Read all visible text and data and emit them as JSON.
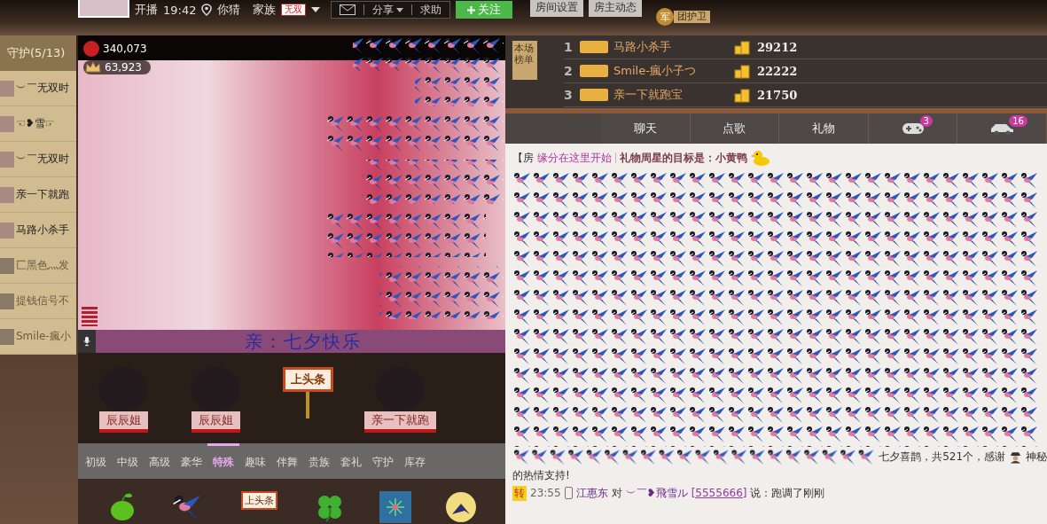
{
  "header": {
    "start_label": "开播",
    "start_time": "19:42",
    "location": "你猜",
    "family_label": "家族",
    "family_badge": "无双",
    "actions": [
      {
        "kind": "mail"
      },
      {
        "kind": "text",
        "label": "分享",
        "dropdown": true
      },
      {
        "kind": "text",
        "label": "求助",
        "dropdown": false
      }
    ],
    "follow_button": "关注",
    "buttons": [
      "房间设置",
      "房主动态"
    ],
    "guard_badge": {
      "icon": "军",
      "label": "团护卫"
    }
  },
  "sidebar": {
    "title": "守护(5/13)",
    "items": [
      {
        "name": "︶￣无双时",
        "online": true
      },
      {
        "name": "☜❥雪☞",
        "online": true
      },
      {
        "name": "︶￣无双时",
        "online": true
      },
      {
        "name": "亲一下就跑",
        "online": true
      },
      {
        "name": "马路小杀手",
        "online": true
      },
      {
        "name": "匚黑色灬发",
        "online": false
      },
      {
        "name": "提钱信号不",
        "online": false
      },
      {
        "name": "Smile-瘋小",
        "online": false
      }
    ]
  },
  "video": {
    "wealth": "340,073",
    "popularity": "63,923",
    "ticker": "亲：七夕快乐"
  },
  "seats": [
    {
      "kind": "user",
      "name": "辰辰姐"
    },
    {
      "kind": "user",
      "name": "辰辰姐"
    },
    {
      "kind": "headline",
      "label": "上头条"
    },
    {
      "kind": "user",
      "name": "亲一下就跑"
    }
  ],
  "gift_tabs": [
    {
      "label": "初级",
      "selected": false
    },
    {
      "label": "中级",
      "selected": false
    },
    {
      "label": "高级",
      "selected": false
    },
    {
      "label": "豪华",
      "selected": false
    },
    {
      "label": "特殊",
      "selected": true
    },
    {
      "label": "趣味",
      "selected": false
    },
    {
      "label": "伴舞",
      "selected": false
    },
    {
      "label": "贵族",
      "selected": false
    },
    {
      "label": "套礼",
      "selected": false
    },
    {
      "label": "守护",
      "selected": false
    },
    {
      "label": "库存",
      "selected": false
    }
  ],
  "gifts": [
    {
      "kind": "bean"
    },
    {
      "kind": "magpie"
    },
    {
      "kind": "headline",
      "label": "上头条"
    },
    {
      "kind": "clover"
    },
    {
      "kind": "firework"
    },
    {
      "kind": "moon"
    }
  ],
  "ranking": {
    "label": "本场榜单",
    "rows": [
      {
        "rank": "1",
        "name": "马路小杀手",
        "score": "29212"
      },
      {
        "rank": "2",
        "name": "Smile-瘋小子つ",
        "score": "22222"
      },
      {
        "rank": "3",
        "name": "亲一下就跑宝",
        "score": "21750"
      }
    ]
  },
  "chat_tabs": [
    {
      "kind": "text",
      "label": "聊天"
    },
    {
      "kind": "text",
      "label": "点歌"
    },
    {
      "kind": "text",
      "label": "礼物"
    },
    {
      "kind": "game",
      "badge": "3"
    },
    {
      "kind": "car",
      "badge": "16"
    }
  ],
  "chat": {
    "notice": {
      "prefix": "【房",
      "link": "缘分在这里开始",
      "goal": "礼物周星的目标是：小黄鸭"
    },
    "messages": [
      {
        "kind": "gift",
        "text": "七夕喜鹊，共521个，感谢",
        "user": "神秘",
        "suffix": "的热情支持!"
      },
      {
        "kind": "chat",
        "tag": "转",
        "time": "23:55",
        "from": "江惠东",
        "to_word": "对",
        "to": "︶￣❥飛雪ル",
        "id": "[5555666]",
        "says": "说：跑调了刚刚"
      }
    ]
  }
}
